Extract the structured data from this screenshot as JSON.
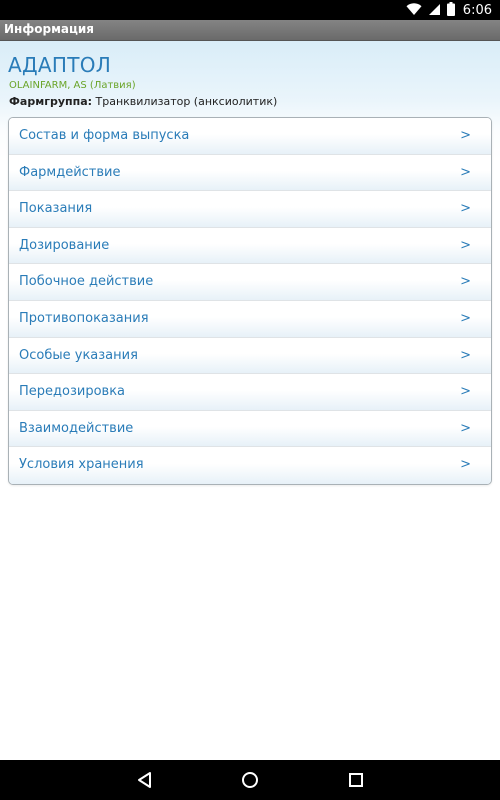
{
  "status_bar": {
    "time": "6:06",
    "icons": [
      "wifi-icon",
      "signal-icon",
      "battery-icon"
    ]
  },
  "app_bar": {
    "title": "Информация"
  },
  "drug": {
    "name": "АДАПТОЛ",
    "manufacturer": "OLAINFARM, AS (Латвия)",
    "pharm_group_label": "Фармгруппа:",
    "pharm_group_value": "Транквилизатор (анксиолитик)"
  },
  "menu": {
    "arrow": ">",
    "items": [
      {
        "label": "Состав и форма выпуска"
      },
      {
        "label": "Фармдействие"
      },
      {
        "label": "Показания"
      },
      {
        "label": "Дозирование"
      },
      {
        "label": "Побочное действие"
      },
      {
        "label": "Противопоказания"
      },
      {
        "label": "Особые указания"
      },
      {
        "label": "Передозировка"
      },
      {
        "label": "Взаимодействие"
      },
      {
        "label": "Условия хранения"
      }
    ]
  },
  "nav_bar": {
    "buttons": [
      "back-icon",
      "home-icon",
      "recents-icon"
    ]
  },
  "colors": {
    "accent": "#2a7cb8",
    "manufacturer": "#6aa428",
    "title_bar": "#7a7a7a"
  }
}
